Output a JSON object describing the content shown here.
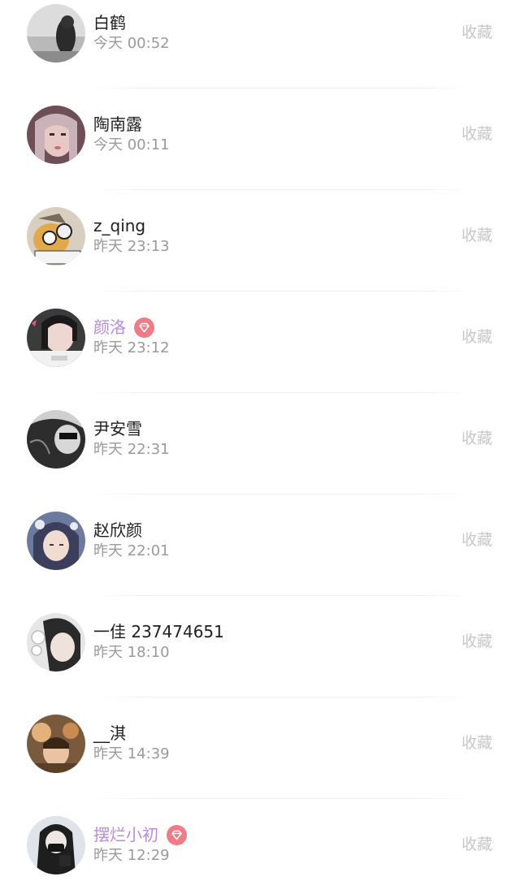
{
  "contacts": [
    {
      "name": "白鹤",
      "time": "今天 00:52",
      "vip": false,
      "action": "收藏",
      "avatar": "avatar-photo-grey-scene"
    },
    {
      "name": "陶南露",
      "time": "今天 00:11",
      "vip": false,
      "action": "收藏",
      "avatar": "avatar-photo-girl"
    },
    {
      "name": "z_qing",
      "time": "昨天 23:13",
      "vip": false,
      "action": "收藏",
      "avatar": "avatar-cartoon"
    },
    {
      "name": "颜洛",
      "time": "昨天 23:12",
      "vip": true,
      "action": "收藏",
      "avatar": "avatar-photo-girl-dark"
    },
    {
      "name": "尹安雪",
      "time": "昨天 22:31",
      "vip": false,
      "action": "收藏",
      "avatar": "avatar-photo-bw"
    },
    {
      "name": "赵欣颜",
      "time": "昨天 22:01",
      "vip": false,
      "action": "收藏",
      "avatar": "avatar-photo-girl-light"
    },
    {
      "name": "一佳 237474651",
      "time": "昨天 18:10",
      "vip": false,
      "action": "收藏",
      "avatar": "avatar-photo-girl-flower"
    },
    {
      "name": "__淇",
      "time": "昨天 14:39",
      "vip": false,
      "action": "收藏",
      "avatar": "avatar-photo-warm"
    },
    {
      "name": "摆烂小初",
      "time": "昨天 12:29",
      "vip": true,
      "action": "收藏",
      "avatar": "avatar-photo-mask"
    }
  ],
  "colors": {
    "vip_name": "#b98be0",
    "vip_badge": "#f07b86",
    "time_text": "#9a9a9a",
    "action_text": "#c7c7c7"
  }
}
